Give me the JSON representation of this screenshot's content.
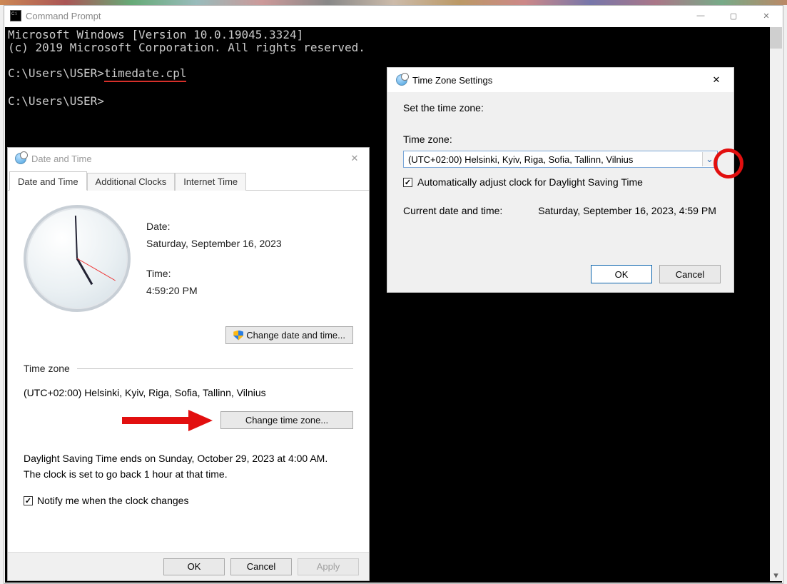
{
  "cmd": {
    "title": "Command Prompt",
    "line1": "Microsoft Windows [Version 10.0.19045.3324]",
    "line2": "(c) 2019 Microsoft Corporation. All rights reserved.",
    "prompt1": "C:\\Users\\USER>",
    "command1": "timedate.cpl",
    "prompt2": "C:\\Users\\USER>"
  },
  "dt": {
    "title": "Date and Time",
    "tab1": "Date and Time",
    "tab2": "Additional Clocks",
    "tab3": "Internet Time",
    "date_label": "Date:",
    "date_value": "Saturday, September 16, 2023",
    "time_label": "Time:",
    "time_value": "4:59:20 PM",
    "change_dt_btn": "Change date and time...",
    "tz_section": "Time zone",
    "tz_value": "(UTC+02:00) Helsinki, Kyiv, Riga, Sofia, Tallinn, Vilnius",
    "change_tz_btn": "Change time zone...",
    "dst_text1": "Daylight Saving Time ends on Sunday, October 29, 2023 at 4:00 AM.",
    "dst_text2": "The clock is set to go back 1 hour at that time.",
    "notify_label": "Notify me when the clock changes",
    "ok": "OK",
    "cancel": "Cancel",
    "apply": "Apply"
  },
  "tz": {
    "title": "Time Zone Settings",
    "set_label": "Set the time zone:",
    "tz_label": "Time zone:",
    "tz_value": "(UTC+02:00) Helsinki, Kyiv, Riga, Sofia, Tallinn, Vilnius",
    "dst_checkbox": "Automatically adjust clock for Daylight Saving Time",
    "current_label": "Current date and time:",
    "current_value": "Saturday, September 16, 2023, 4:59 PM",
    "ok": "OK",
    "cancel": "Cancel"
  }
}
